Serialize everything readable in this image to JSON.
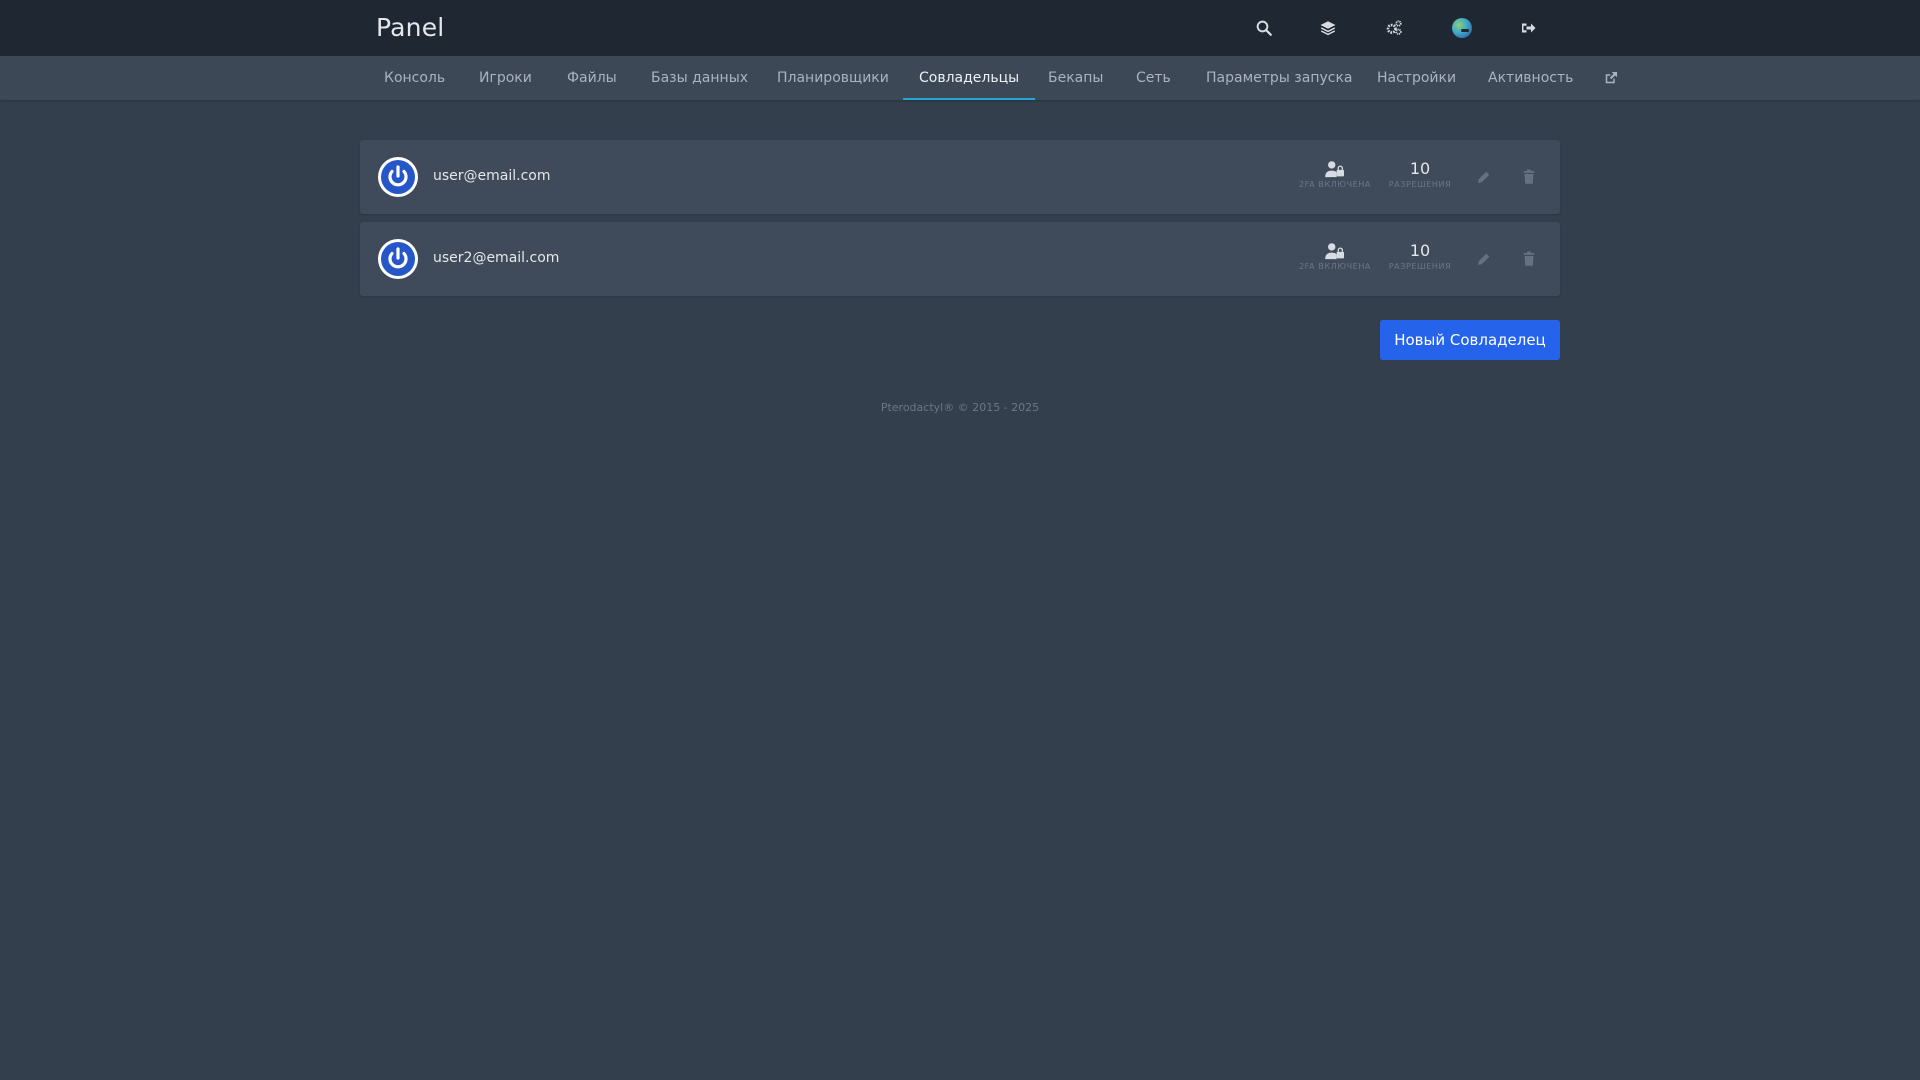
{
  "header": {
    "brand": "Panel",
    "icons": [
      "search-icon",
      "layers-icon",
      "cogs-icon",
      "user-avatar",
      "logout-icon"
    ]
  },
  "tabs": [
    {
      "label": "Консоль",
      "active": false
    },
    {
      "label": "Игроки",
      "active": false
    },
    {
      "label": "Файлы",
      "active": false
    },
    {
      "label": "Базы данных",
      "active": false
    },
    {
      "label": "Планировщики",
      "active": false
    },
    {
      "label": "Совладельцы",
      "active": true
    },
    {
      "label": "Бекапы",
      "active": false
    },
    {
      "label": "Сеть",
      "active": false
    },
    {
      "label": "Параметры запуска",
      "active": false
    },
    {
      "label": "Настройки",
      "active": false
    },
    {
      "label": "Активность",
      "active": false
    }
  ],
  "subusers": [
    {
      "email": "user@email.com",
      "twofa_label": "2FA ВКЛЮЧЕНА",
      "permissions": "10",
      "permissions_label": "РАЗРЕШЕНИЯ"
    },
    {
      "email": "user2@email.com",
      "twofa_label": "2FA ВКЛЮЧЕНА",
      "permissions": "10",
      "permissions_label": "РАЗРЕШЕНИЯ"
    }
  ],
  "actions": {
    "new_subuser": "Новый Совладелец"
  },
  "footer": {
    "text": "Pterodactyl® © 2015 - 2025"
  },
  "colors": {
    "background": "#333f4d",
    "topbar": "#1f2733",
    "subnav": "#3c4856",
    "row": "#3f4b5a",
    "accent": "#25a7d4",
    "primary_button": "#2563eb"
  }
}
